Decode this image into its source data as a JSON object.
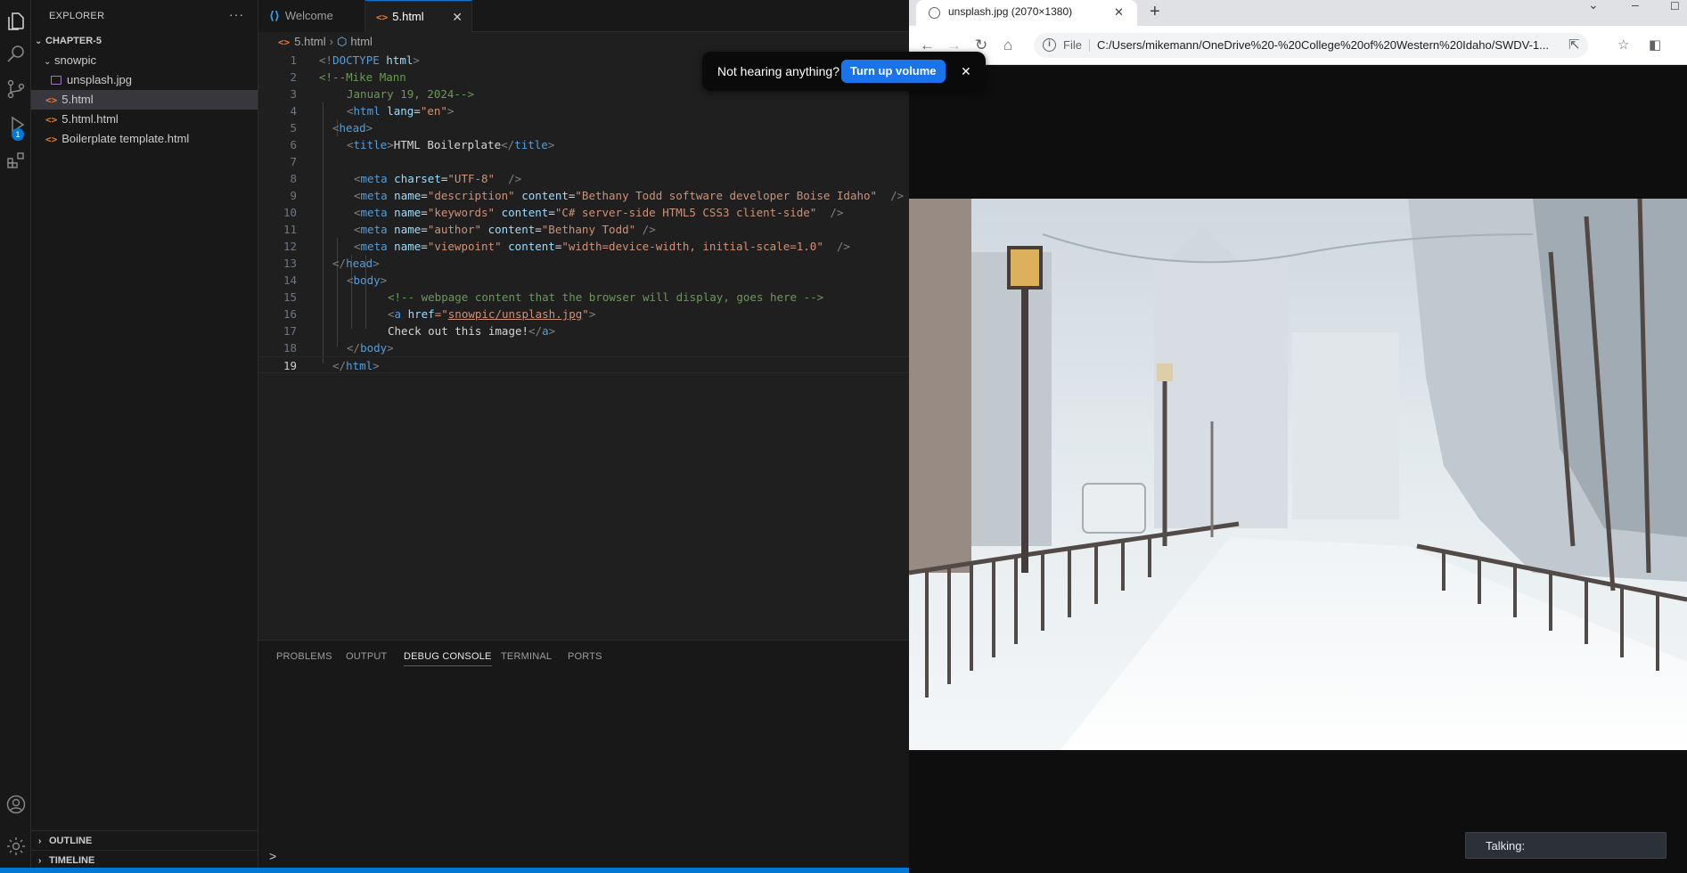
{
  "vscode": {
    "explorer_title": "EXPLORER",
    "explorer_more": "···",
    "debug_badge": "1",
    "folder": "CHAPTER-5",
    "subfolder": "snowpic",
    "files": {
      "image": "unsplash.jpg",
      "f1": "5.html",
      "f2": "5.html.html",
      "f3": "Boilerplate template.html"
    },
    "outline": "OUTLINE",
    "timeline": "TIMELINE",
    "tabs": {
      "welcome": "Welcome",
      "active": "5.html",
      "close": "✕"
    },
    "breadcrumb": {
      "file": "5.html",
      "sep": "›",
      "symbol": "html"
    },
    "line_numbers": [
      "1",
      "2",
      "3",
      "4",
      "5",
      "6",
      "7",
      "8",
      "9",
      "10",
      "11",
      "12",
      "13",
      "14",
      "15",
      "16",
      "17",
      "18",
      "19"
    ],
    "code": {
      "l1": {
        "a": "<!",
        "b": "DOCTYPE",
        "c": "html",
        "d": ">"
      },
      "l2": "<!--Mike Mann",
      "l3": "January 19, 2024-->",
      "l4": {
        "a": "<",
        "b": "html",
        "c": "lang",
        "d": "=",
        "e": "\"en\"",
        "f": ">"
      },
      "l5": {
        "a": "<",
        "b": "head",
        "c": ">"
      },
      "l6": {
        "a": "<",
        "b": "title",
        "c": ">",
        "d": "HTML Boilerplate",
        "e": "</",
        "f": "title",
        "g": ">"
      },
      "l8": {
        "tag": "meta",
        "attr": "charset",
        "eq": "=",
        "val": "\"UTF-8\"",
        "end": "  />"
      },
      "l9": {
        "tag": "meta",
        "attr1": "name",
        "val1": "\"description\"",
        "attr2": "content",
        "val2": "\"Bethany Todd software developer Boise Idaho\"",
        "end": "  />"
      },
      "l10": {
        "tag": "meta",
        "attr1": "name",
        "val1": "\"keywords\"",
        "attr2": "content",
        "val2": "\"C# server-side HTML5 CSS3 client-side\"",
        "end": "  />"
      },
      "l11": {
        "tag": "meta",
        "attr1": "name",
        "val1": "\"author\"",
        "attr2": "content",
        "val2": "\"Bethany Todd\"",
        "end": " />"
      },
      "l12": {
        "tag": "meta",
        "attr1": "name",
        "val1": "\"viewpoint\"",
        "attr2": "content",
        "val2": "\"width=device-width, initial-scale=1.0\"",
        "end": "  />"
      },
      "l13": {
        "a": "</",
        "b": "head",
        "c": ">"
      },
      "l14": {
        "a": "<",
        "b": "body",
        "c": ">"
      },
      "l15": "<!-- webpage content that the browser will display, goes here -->",
      "l16": {
        "a": "<",
        "b": "a",
        "c": "href",
        "d": "=\"",
        "e": "snowpic/unsplash.jpg",
        "f": "\"",
        "g": ">"
      },
      "l17": {
        "text": "Check out this image!",
        "a": "</",
        "b": "a",
        "c": ">"
      },
      "l18": {
        "a": "</",
        "b": "body",
        "c": ">"
      },
      "l19": {
        "a": "</",
        "b": "html",
        "c": ">"
      }
    },
    "panel_tabs": [
      "PROBLEMS",
      "OUTPUT",
      "DEBUG CONSOLE",
      "TERMINAL",
      "PORTS"
    ],
    "panel_active": "DEBUG CONSOLE",
    "panel_prompt": ">",
    "colors": {
      "accent": "#0078d4",
      "tag": "#569cd6",
      "attr": "#9cdcfe",
      "string": "#ce9178",
      "comment": "#6a9955"
    }
  },
  "toast": {
    "message": "Not hearing anything?",
    "button": "Turn up volume",
    "close": "✕"
  },
  "chrome": {
    "tab_title": "unsplash.jpg (2070×1380)",
    "tab_close": "✕",
    "new_tab": "+",
    "omnibox_scheme": "File",
    "omnibox_url": "C:/Users/mikemann/OneDrive%20-%20College%20of%20Western%20Idaho/SWDV-1...",
    "talking_label": "Talking:",
    "icons": [
      "back-arrow-icon",
      "forward-arrow-icon",
      "reload-icon",
      "home-icon",
      "info-icon",
      "share-icon",
      "star-icon",
      "sidebar-icon"
    ]
  }
}
